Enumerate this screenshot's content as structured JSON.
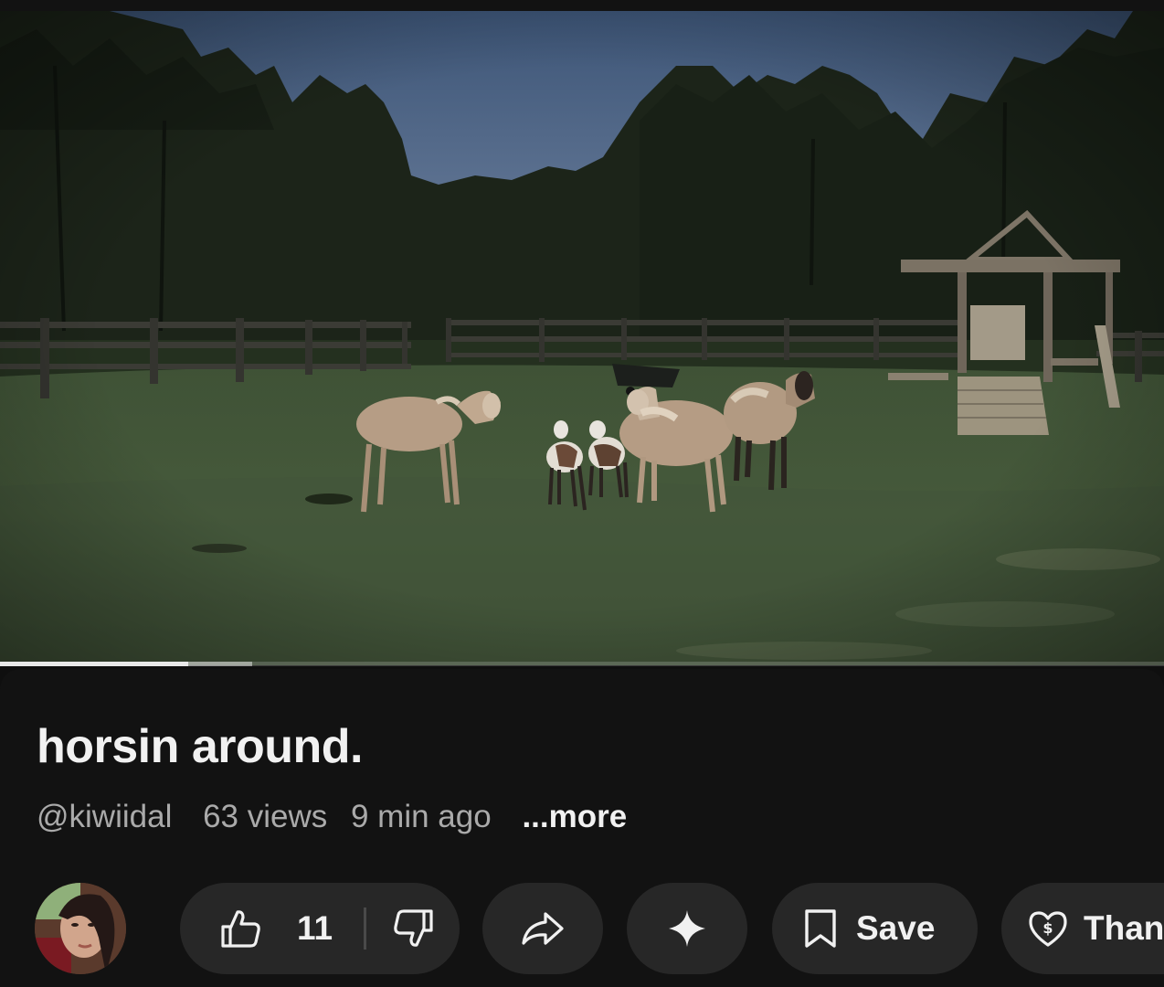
{
  "video": {
    "progress_played_fraction": 0.162,
    "progress_buffered_fraction": 0.217,
    "scene_icon": "sheep-pasture-scene"
  },
  "info": {
    "title": "horsin around.",
    "channel_handle": "@kiwiidal",
    "views": "63 views",
    "time_ago": "9 min ago",
    "more_label": "...more"
  },
  "actions": {
    "avatar_icon": "channel-avatar",
    "like_icon": "thumbs-up-icon",
    "like_count": "11",
    "dislike_icon": "thumbs-down-icon",
    "share_icon": "share-arrow-icon",
    "remix_icon": "sparkle-icon",
    "save_icon": "bookmark-icon",
    "save_label": "Save",
    "thanks_icon": "heart-dollar-icon",
    "thanks_label": "Than"
  },
  "colors": {
    "background": "#0f0f0f",
    "panel": "#121212",
    "pill": "#272727",
    "primary_text": "#f1f1f1",
    "secondary_text": "#aaaaaa"
  }
}
